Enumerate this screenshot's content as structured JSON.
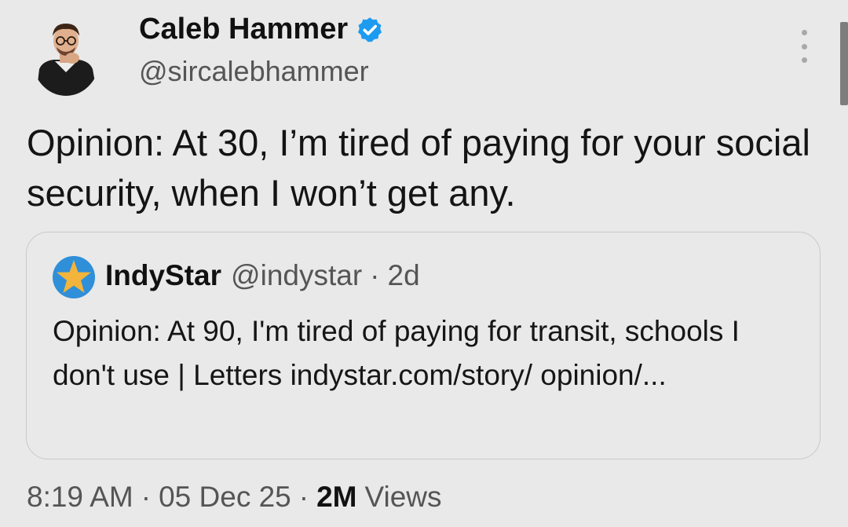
{
  "author": {
    "display_name": "Caleb Hammer",
    "handle": "@sircalebhammer",
    "verified_icon": "verified-badge-icon",
    "verified_color": "#1d9bf0"
  },
  "tweet": {
    "text": "Opinion: At 30, I’m tired of paying for your social security, when I won’t get any."
  },
  "quote": {
    "name": "IndyStar",
    "handle": "@indystar",
    "separator": "·",
    "time": "2d",
    "text": "Opinion: At 90, I'm tired of paying for transit, schools I don't use | Letters indystar.com/story/ opinion/..."
  },
  "meta": {
    "time": "8:19 AM",
    "dot1": "·",
    "date": "05 Dec 25",
    "dot2": "·",
    "views_count": "2M",
    "views_label": "Views"
  },
  "colors": {
    "background": "#e9e9e9",
    "text": "#141414",
    "secondary_text": "#555555",
    "border": "#c9c9c9",
    "indystar_blue": "#2f8fd8",
    "indystar_star": "#f2b43c"
  }
}
